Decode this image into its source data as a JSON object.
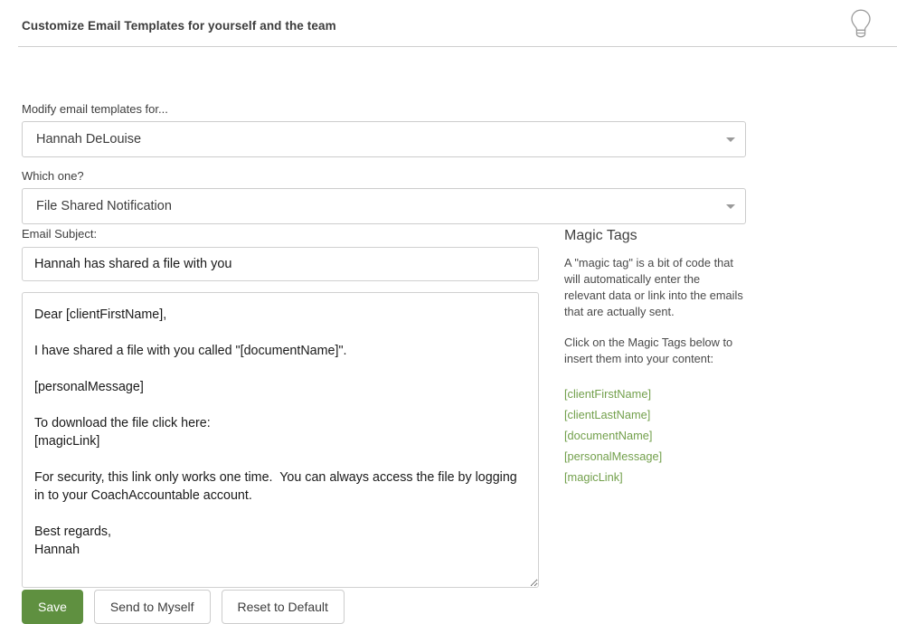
{
  "header": {
    "title": "Customize Email Templates for yourself and the team",
    "hint_icon": "lightbulb-icon"
  },
  "form": {
    "modify_for_label": "Modify email templates for...",
    "modify_for_value": "Hannah DeLouise",
    "which_one_label": "Which one?",
    "which_one_value": "File Shared Notification",
    "subject_label": "Email Subject:",
    "subject_value": "Hannah has shared a file with you",
    "body_value": "Dear [clientFirstName],\n\nI have shared a file with you called \"[documentName]\".\n\n[personalMessage]\n\nTo download the file click here:\n[magicLink]\n\nFor security, this link only works one time.  You can always access the file by logging in to your CoachAccountable account.\n\nBest regards,\nHannah"
  },
  "magic_tags": {
    "title": "Magic Tags",
    "description": "A \"magic tag\" is a bit of code that will automatically enter the relevant data or link into the emails that are actually sent.",
    "instruction": "Click on the Magic Tags below to insert them into your content:",
    "tags": [
      "[clientFirstName]",
      "[clientLastName]",
      "[documentName]",
      "[personalMessage]",
      "[magicLink]"
    ],
    "link_color": "#73a04c"
  },
  "buttons": {
    "save": "Save",
    "send_to_myself": "Send to Myself",
    "reset_to_default": "Reset to Default",
    "save_color": "#5f9040"
  }
}
